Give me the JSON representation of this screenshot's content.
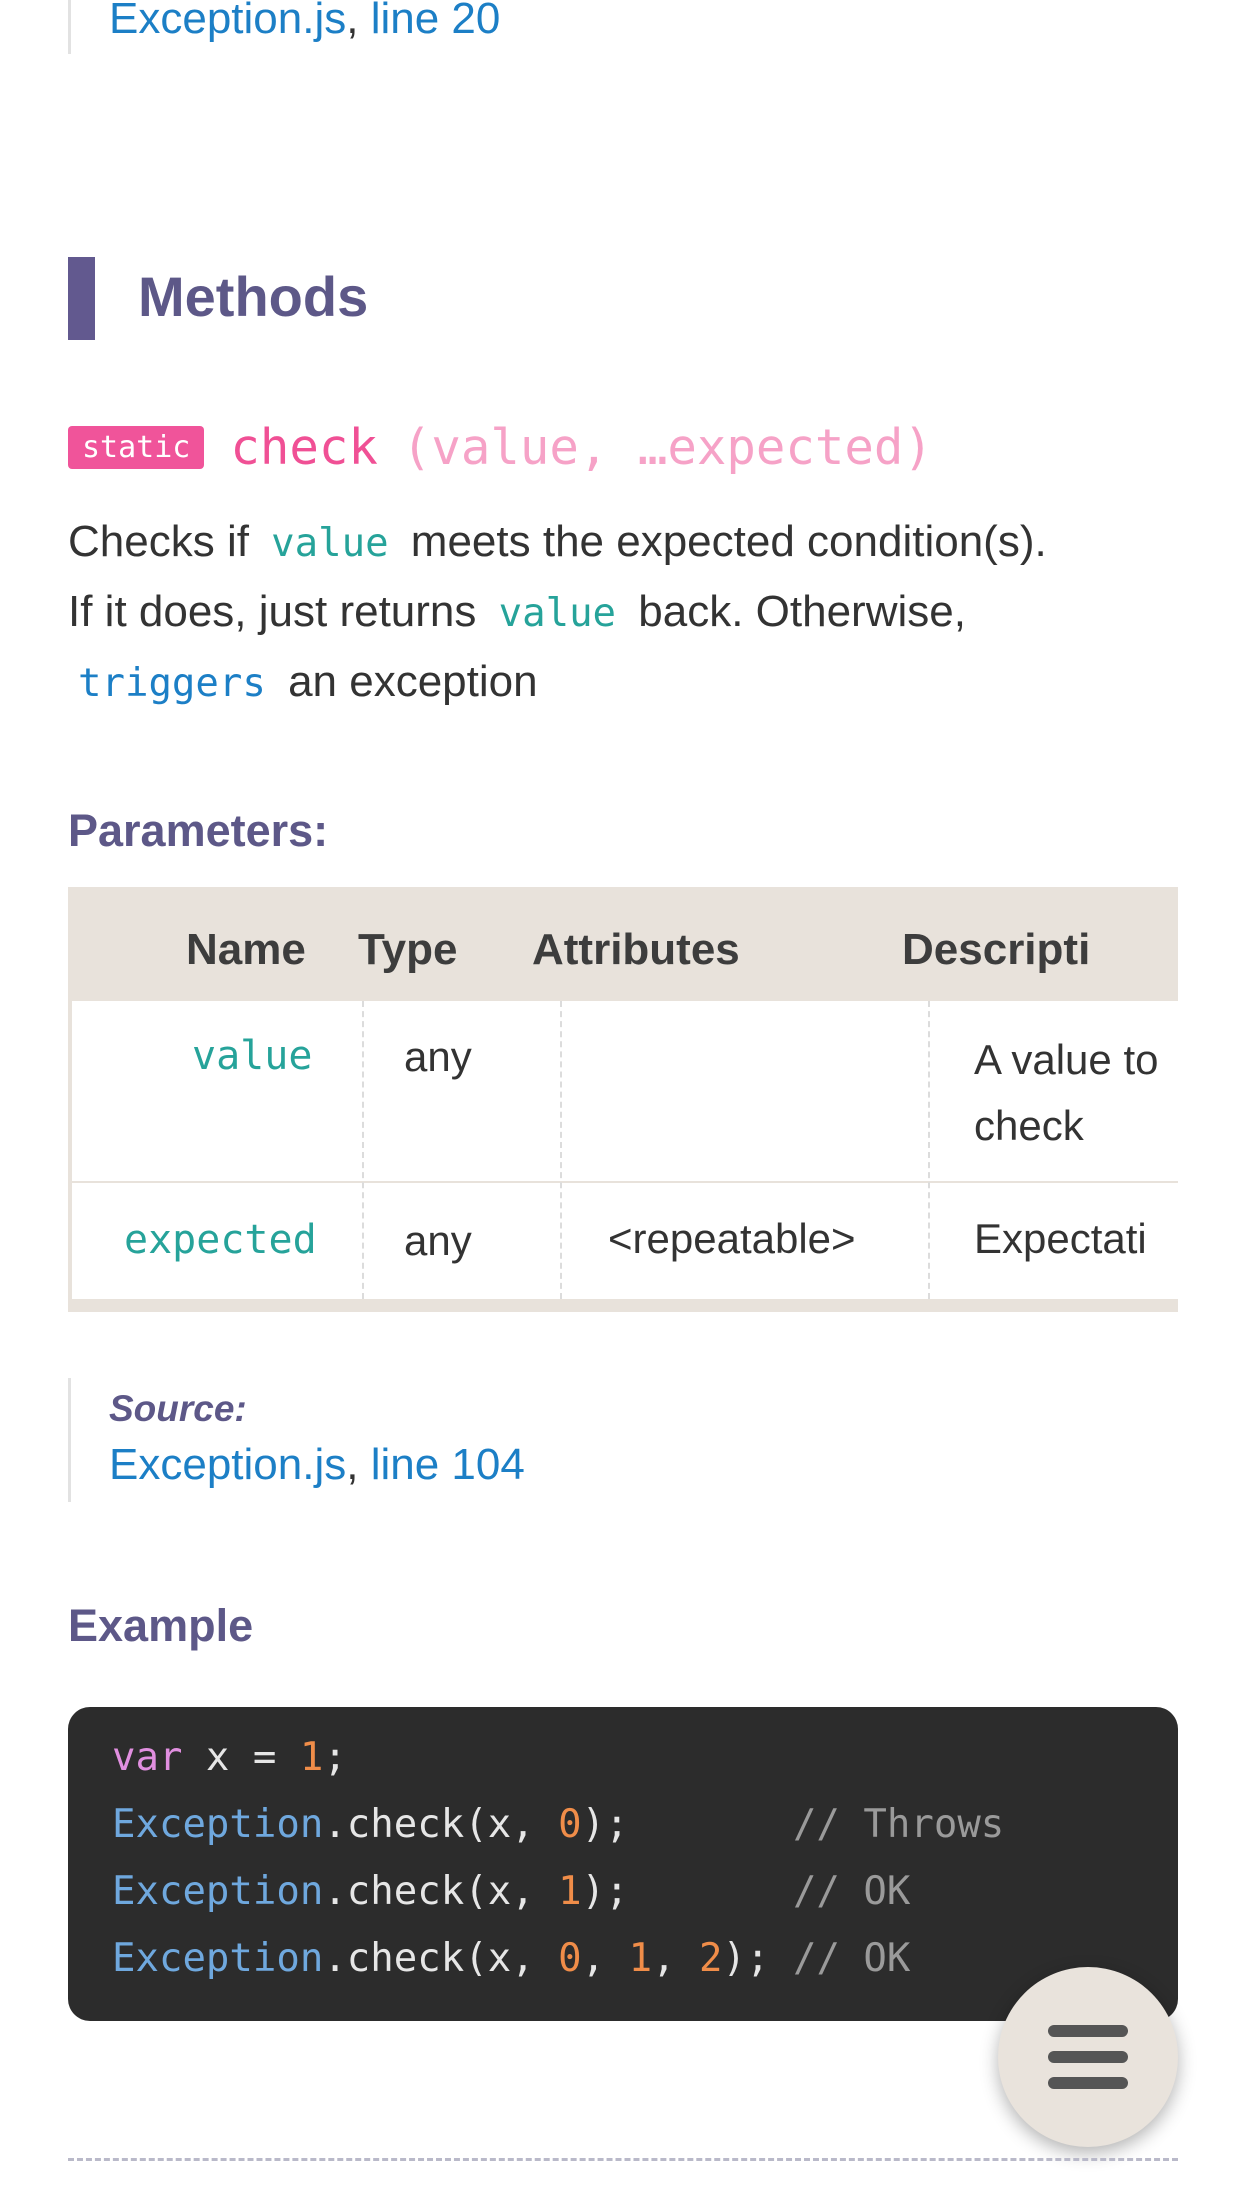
{
  "top_source": {
    "file_link": "Exception.js",
    "separator": ", ",
    "line_link": "line 20"
  },
  "methods_heading": "Methods",
  "method": {
    "badge": "static",
    "name": "check",
    "params": "(value, …expected)",
    "description": {
      "part1": "Checks if ",
      "code1": "value",
      "part2": " meets the expected condition(s).",
      "part3": "If it does, just returns ",
      "code2": "value",
      "part4": " back. Otherwise,",
      "link": "triggers",
      "part5": " an exception"
    }
  },
  "parameters_heading": "Parameters:",
  "parameters_table": {
    "headers": [
      "Name",
      "Type",
      "Attributes",
      "Descripti"
    ],
    "rows": [
      {
        "name": "value",
        "type": "any",
        "attributes": "",
        "description_line1": "A value to",
        "description_line2": "check"
      },
      {
        "name": "expected",
        "type": "any",
        "attributes": "<repeatable>",
        "description_line1": "Expectati",
        "description_line2": ""
      }
    ]
  },
  "source": {
    "label": "Source:",
    "file_link": "Exception.js",
    "separator": ", ",
    "line_link": "line 104"
  },
  "example_heading": "Example",
  "code": {
    "line1": {
      "kw": "var",
      "rest": " x = ",
      "num": "1",
      "end": ";"
    },
    "line2": {
      "cls": "Exception",
      "call": ".check(x, ",
      "n1": "0",
      "end": ");       ",
      "comment": "// Throws"
    },
    "line3": {
      "cls": "Exception",
      "call": ".check(x, ",
      "n1": "1",
      "end": ");       ",
      "comment": "// OK"
    },
    "line4": {
      "cls": "Exception",
      "call": ".check(x, ",
      "n1": "0",
      "s1": ", ",
      "n2": "1",
      "s2": ", ",
      "n3": "2",
      "end": "); ",
      "comment": "// OK"
    }
  },
  "menu_button": {
    "icon": "hamburger-icon"
  },
  "colors": {
    "accent_purple": "#5d5888",
    "badge_pink": "#f0549a",
    "link_blue": "#1c7fc6",
    "code_teal": "#26a39a",
    "code_bg": "#2c2c2c",
    "table_header_bg": "#e8e2db"
  }
}
